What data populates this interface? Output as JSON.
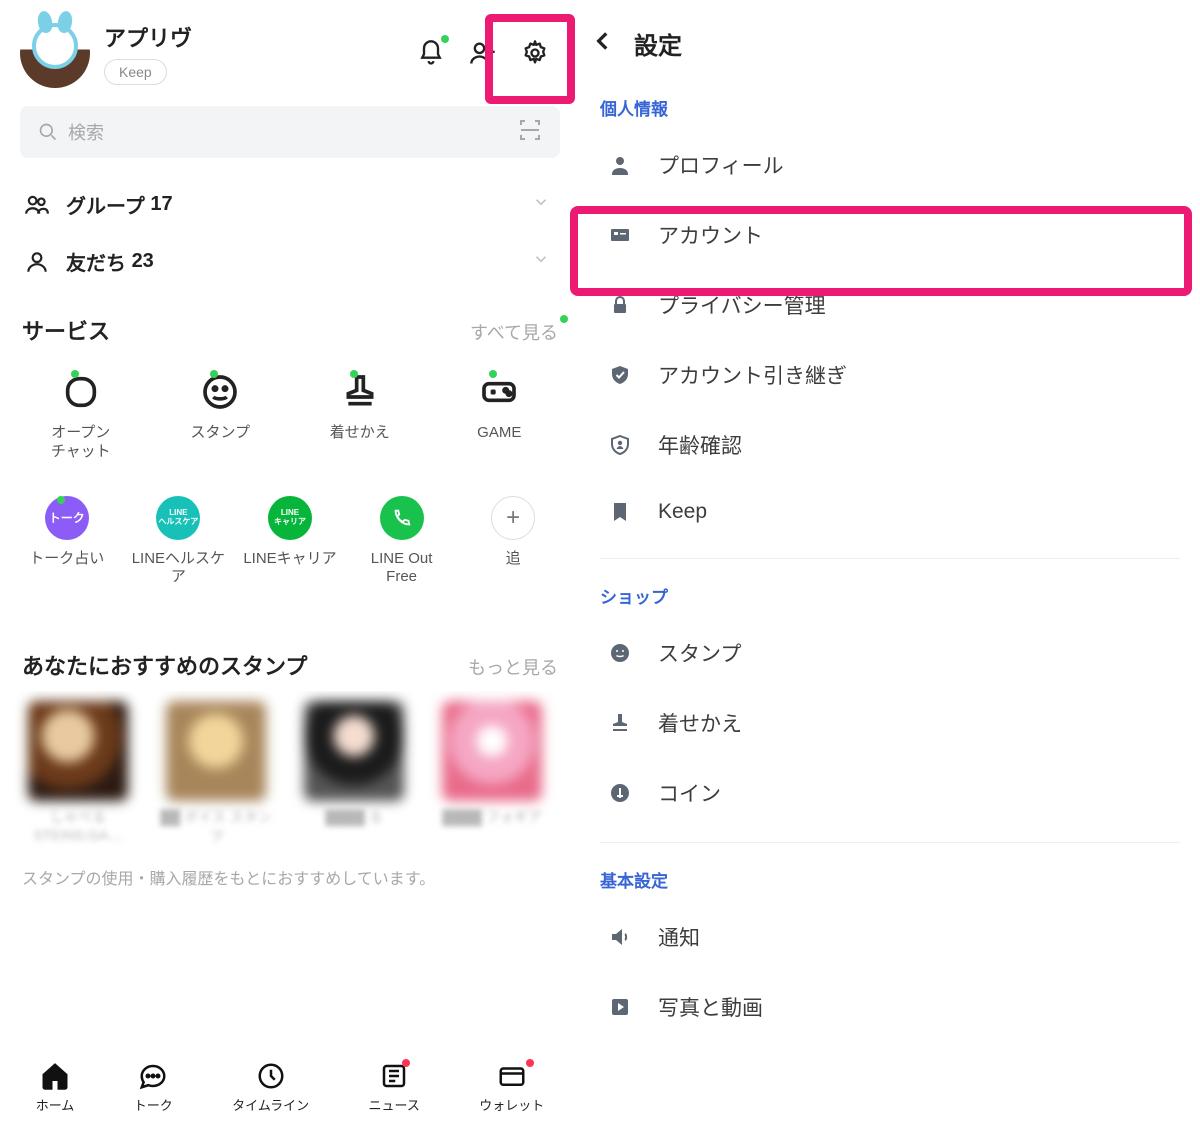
{
  "left": {
    "profile": {
      "name": "アプリヴ",
      "keep": "Keep"
    },
    "search_placeholder": "検索",
    "groups": {
      "label": "グループ",
      "count": "17"
    },
    "friends": {
      "label": "友だち",
      "count": "23"
    },
    "services": {
      "title": "サービス",
      "all_link": "すべて見る",
      "row1": [
        {
          "label": "オープン\nチャット"
        },
        {
          "label": "スタンプ"
        },
        {
          "label": "着せかえ"
        },
        {
          "label": "GAME"
        }
      ],
      "row2": [
        {
          "label": "トーク占い",
          "badge": "トーク"
        },
        {
          "label": "LINEヘルスケア",
          "badge": "LINE\nヘルスケア"
        },
        {
          "label": "LINEキャリア",
          "badge": "LINE\nキャリア"
        },
        {
          "label": "LINE Out\nFree"
        },
        {
          "label": "追"
        }
      ]
    },
    "stamps": {
      "title": "あなたにおすすめのスタンプ",
      "more": "もっと見る",
      "hint": "スタンプの使用・購入履歴をもとにおすすめしています。"
    },
    "nav": {
      "home": "ホーム",
      "talk": "トーク",
      "timeline": "タイムライン",
      "news": "ニュース",
      "wallet": "ウォレット"
    }
  },
  "right": {
    "title": "設定",
    "sections": {
      "personal": {
        "label": "個人情報",
        "items": {
          "profile": "プロフィール",
          "account": "アカウント",
          "privacy": "プライバシー管理",
          "transfer": "アカウント引き継ぎ",
          "age": "年齢確認",
          "keep": "Keep"
        }
      },
      "shop": {
        "label": "ショップ",
        "items": {
          "stamp": "スタンプ",
          "theme": "着せかえ",
          "coin": "コイン"
        }
      },
      "basic": {
        "label": "基本設定",
        "items": {
          "notif": "通知",
          "media": "写真と動画"
        }
      }
    }
  }
}
